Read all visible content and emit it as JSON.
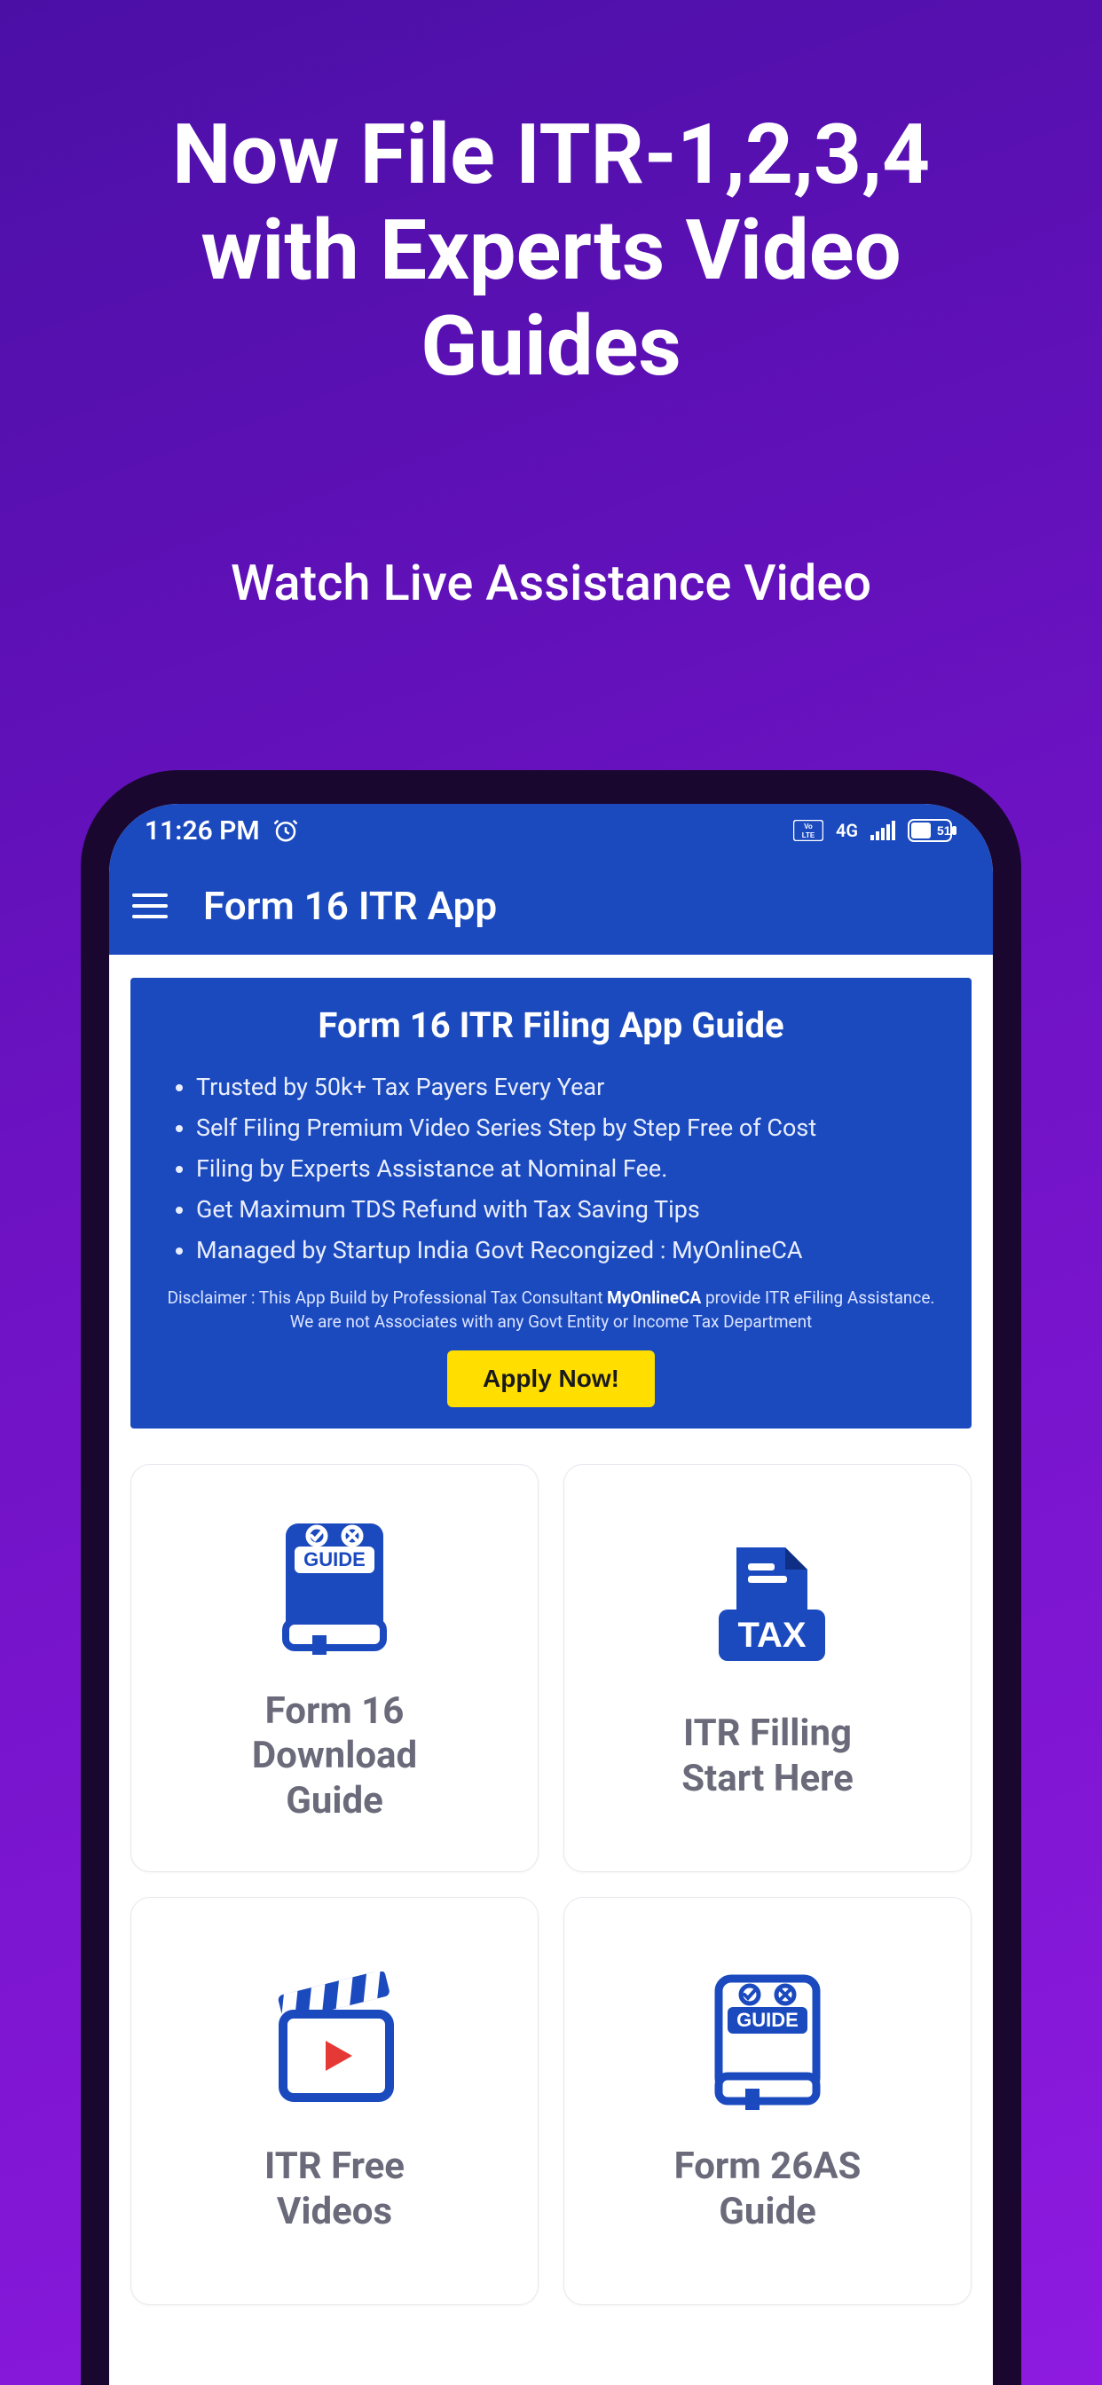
{
  "promo": {
    "title_l1": "Now File ITR-1,2,3,4",
    "title_l2": "with Experts Video",
    "title_l3": "Guides",
    "subtitle": "Watch Live Assistance Video"
  },
  "statusbar": {
    "time": "11:26 PM",
    "volte_label": "Vo LTE",
    "network_label": "4G",
    "battery_pct": "51"
  },
  "appbar": {
    "title": "Form 16 ITR App"
  },
  "hero": {
    "title": "Form 16 ITR Filing App Guide",
    "bullets": [
      "Trusted by 50k+ Tax Payers Every Year",
      "Self Filing Premium Video Series Step by Step Free of Cost",
      "Filing by Experts Assistance at Nominal Fee.",
      "Get Maximum TDS Refund with Tax Saving Tips",
      "Managed by Startup India Govt Recongized : MyOnlineCA"
    ],
    "disclaimer_pre": "Disclaimer : This App Build by Professional Tax Consultant ",
    "disclaimer_bold": "MyOnlineCA",
    "disclaimer_post": " provide ITR eFiling Assistance. We are not Associates with any Govt Entity or Income Tax Department",
    "apply_label": "Apply Now!"
  },
  "cards": [
    {
      "label": "Form 16\nDownload\nGuide",
      "icon": "guide-book-icon"
    },
    {
      "label": "ITR Filling\nStart Here",
      "icon": "tax-file-icon"
    },
    {
      "label": "ITR Free\nVideos",
      "icon": "clapper-play-icon"
    },
    {
      "label": "Form 26AS\nGuide",
      "icon": "guide-book-icon"
    }
  ],
  "colors": {
    "brand_blue": "#1b4abf",
    "grad_a": "#4b0fa6",
    "grad_b": "#8e1ae0",
    "cta_yellow": "#ffde00",
    "card_text": "#6a6a7a"
  }
}
